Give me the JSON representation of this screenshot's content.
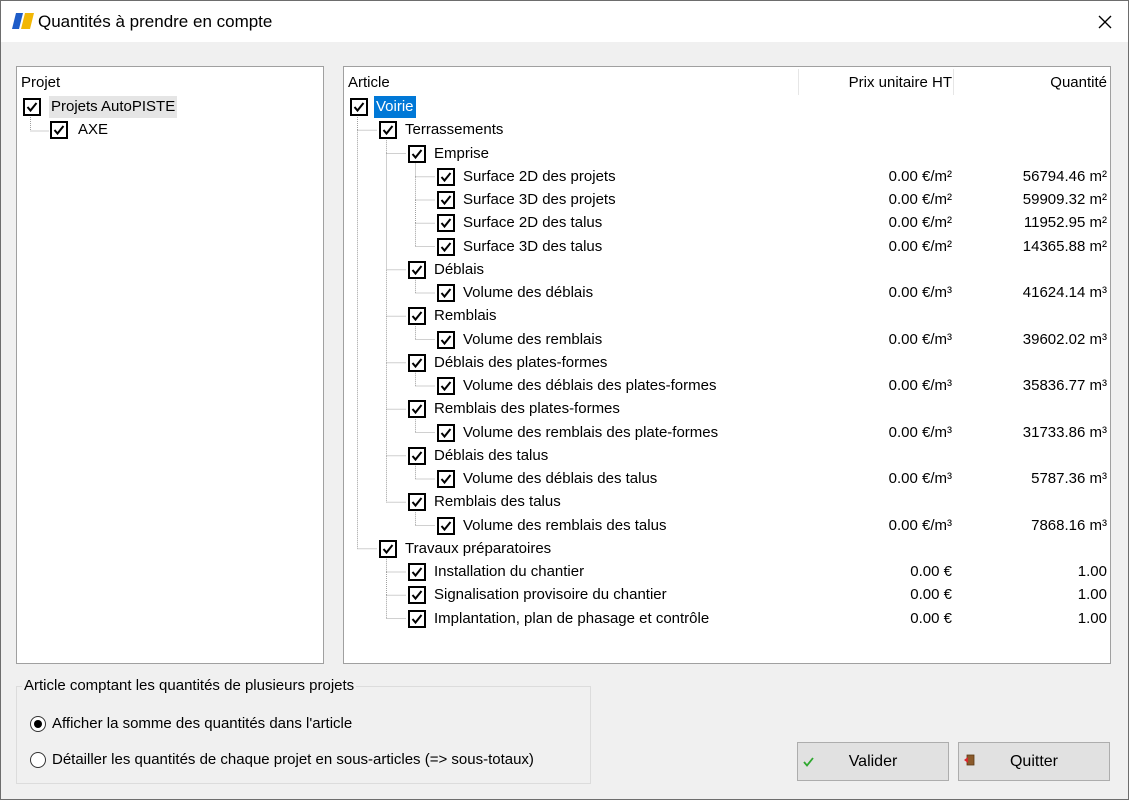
{
  "window": {
    "title": "Quantités à prendre en compte"
  },
  "left_panel": {
    "header": "Projet",
    "items": [
      {
        "label": "Projets AutoPISTE",
        "checked": true
      },
      {
        "label": "AXE",
        "checked": true
      }
    ]
  },
  "right_panel": {
    "columns": [
      "Article",
      "Prix unitaire HT",
      "Quantité"
    ],
    "rows": [
      {
        "label": "Voirie",
        "price": "",
        "qty": ""
      },
      {
        "label": "Terrassements",
        "price": "",
        "qty": ""
      },
      {
        "label": "Emprise",
        "price": "",
        "qty": ""
      },
      {
        "label": "Surface 2D des projets",
        "price": "0.00 €/m²",
        "qty": "56794.46 m²"
      },
      {
        "label": "Surface 3D des projets",
        "price": "0.00 €/m²",
        "qty": "59909.32 m²"
      },
      {
        "label": "Surface 2D des talus",
        "price": "0.00 €/m²",
        "qty": "11952.95 m²"
      },
      {
        "label": "Surface 3D des talus",
        "price": "0.00 €/m²",
        "qty": "14365.88 m²"
      },
      {
        "label": "Déblais",
        "price": "",
        "qty": ""
      },
      {
        "label": "Volume des déblais",
        "price": "0.00 €/m³",
        "qty": "41624.14 m³"
      },
      {
        "label": "Remblais",
        "price": "",
        "qty": ""
      },
      {
        "label": "Volume des remblais",
        "price": "0.00 €/m³",
        "qty": "39602.02 m³"
      },
      {
        "label": "Déblais des plates-formes",
        "price": "",
        "qty": ""
      },
      {
        "label": "Volume des déblais des plates-formes",
        "price": "0.00 €/m³",
        "qty": "35836.77 m³"
      },
      {
        "label": "Remblais des plates-formes",
        "price": "",
        "qty": ""
      },
      {
        "label": "Volume des remblais des plate-formes",
        "price": "0.00 €/m³",
        "qty": "31733.86 m³"
      },
      {
        "label": "Déblais des talus",
        "price": "",
        "qty": ""
      },
      {
        "label": "Volume des déblais des talus",
        "price": "0.00 €/m³",
        "qty": "5787.36 m³"
      },
      {
        "label": "Remblais des talus",
        "price": "",
        "qty": ""
      },
      {
        "label": "Volume des remblais des talus",
        "price": "0.00 €/m³",
        "qty": "7868.16 m³"
      },
      {
        "label": "Travaux préparatoires",
        "price": "",
        "qty": ""
      },
      {
        "label": "Installation du chantier",
        "price": "0.00 €",
        "qty": "1.00"
      },
      {
        "label": "Signalisation provisoire du chantier",
        "price": "0.00 €",
        "qty": "1.00"
      },
      {
        "label": "Implantation, plan de phasage et contrôle",
        "price": "0.00 €",
        "qty": "1.00"
      }
    ]
  },
  "options": {
    "title": "Article comptant les quantités de plusieurs projets",
    "radios": [
      {
        "label": "Afficher la somme des quantités dans l'article",
        "selected": true
      },
      {
        "label": "Détailler les quantités de chaque projet en sous-articles (=> sous-totaux)",
        "selected": false
      }
    ]
  },
  "buttons": {
    "validate": "Valider",
    "quit": "Quitter"
  },
  "colors": {
    "selection": "#0078d7",
    "background": "#f0f0f0",
    "button": "#e1e1e1"
  }
}
